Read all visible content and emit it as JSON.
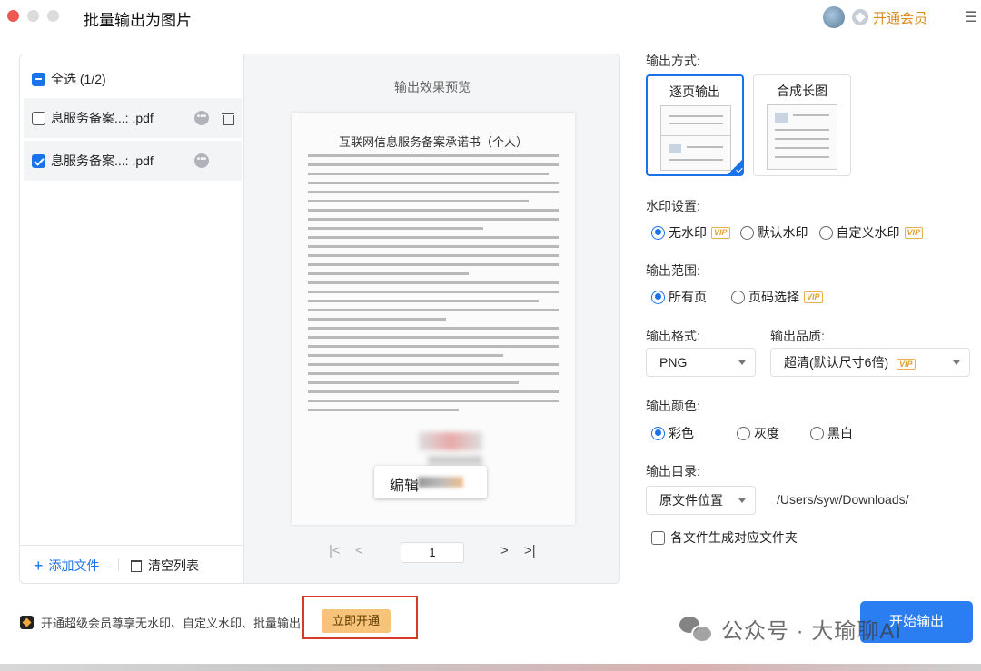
{
  "window": {
    "title": "批量输出为图片"
  },
  "header": {
    "vip_link": "开通会员"
  },
  "file_list": {
    "select_all": "全选 (1/2)",
    "items": [
      {
        "name": "息服务备案...: .pdf",
        "checked": false
      },
      {
        "name": "息服务备案...: .pdf",
        "checked": true
      }
    ],
    "add_file": "添加文件",
    "clear_list": "清空列表"
  },
  "preview": {
    "title": "输出效果预览",
    "doc_heading": "互联网信息服务备案承诺书（个人）",
    "edit_popup": "编辑",
    "page": "1"
  },
  "settings": {
    "output_mode": {
      "label": "输出方式:",
      "options": [
        "逐页输出",
        "合成长图"
      ],
      "selected": "逐页输出"
    },
    "watermark": {
      "label": "水印设置:",
      "options": [
        "无水印",
        "默认水印",
        "自定义水印"
      ],
      "selected": "无水印",
      "vip_tag": "VIP"
    },
    "range": {
      "label": "输出范围:",
      "options": [
        "所有页",
        "页码选择"
      ],
      "selected": "所有页"
    },
    "format": {
      "label": "输出格式:",
      "value": "PNG"
    },
    "quality": {
      "label": "输出品质:",
      "value": "超清(默认尺寸6倍)"
    },
    "color": {
      "label": "输出颜色:",
      "options": [
        "彩色",
        "灰度",
        "黑白"
      ],
      "selected": "彩色"
    },
    "directory": {
      "label": "输出目录:",
      "value": "原文件位置",
      "path": "/Users/syw/Downloads/"
    },
    "subfolder_checkbox": "各文件生成对应文件夹"
  },
  "footer": {
    "promo_text": "开通超级会员尊享无水印、自定义水印、批量输出",
    "promo_button": "立即开通",
    "start_button": "开始输出"
  },
  "overlay_watermark": "公众号 · 大瑜聊AI",
  "colors": {
    "accent": "#1a73e8",
    "vip": "#e0a030",
    "highlight_frame": "#d63a2b"
  }
}
